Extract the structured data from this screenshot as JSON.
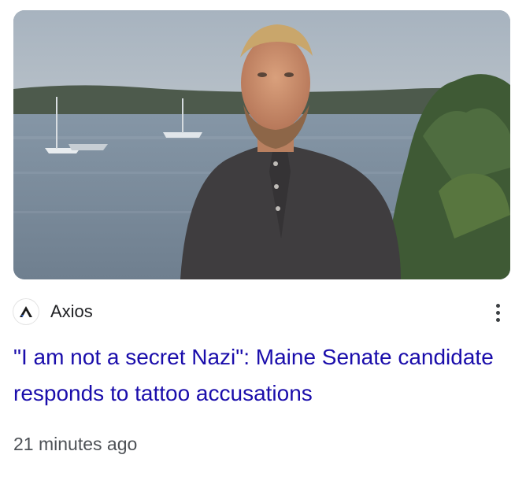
{
  "article": {
    "image_alt": "Man in dark henley shirt standing in front of a harbor with boats and trees",
    "source": {
      "name": "Axios",
      "logo_icon": "axios-logo-icon"
    },
    "menu_icon": "more-vert-icon",
    "headline": "\"I am not a secret Nazi\": Maine Senate candidate responds to tattoo accusations",
    "timestamp": "21 minutes ago"
  },
  "colors": {
    "headline": "#1a0dab",
    "source_text": "#202124",
    "timestamp": "#4d5156"
  }
}
